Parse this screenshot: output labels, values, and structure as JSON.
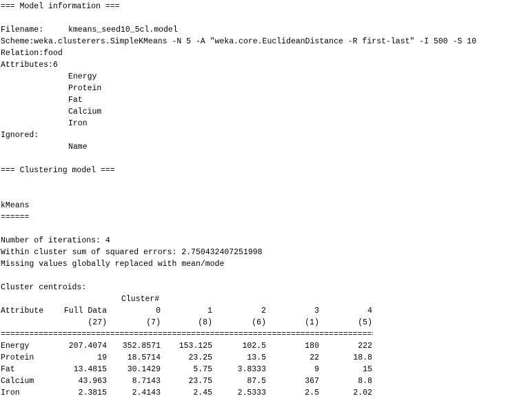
{
  "model_info": {
    "header": "=== Model information ===",
    "filename_label": "Filename:",
    "filename_value": "kmeans_seed10_5cl.model",
    "scheme": "Scheme:weka.clusterers.SimpleKMeans -N 5 -A \"weka.core.EuclideanDistance -R first-last\" -I 500 -S 10",
    "relation": "Relation:food",
    "attributes_label": "Attributes:6",
    "attributes": [
      "Energy",
      "Protein",
      "Fat",
      "Calcium",
      "Iron"
    ],
    "ignored_label": "Ignored:",
    "ignored": [
      "Name"
    ]
  },
  "clustering": {
    "header": "=== Clustering model ===",
    "algorithm": "kMeans",
    "algorithm_underline": "======",
    "iterations": "Number of iterations: 4",
    "sse": "Within cluster sum of squared errors: 2.750432407251998",
    "missing": "Missing values globally replaced with mean/mode",
    "centroids_label": "Cluster centroids:",
    "cluster_header": "Cluster#",
    "table": {
      "attr_header": "Attribute",
      "full_data_header": "Full Data",
      "cluster_ids": [
        "0",
        "1",
        "2",
        "3",
        "4"
      ],
      "full_data_count": "(27)",
      "cluster_counts": [
        "(7)",
        "(8)",
        "(6)",
        "(1)",
        "(5)"
      ],
      "separator": "=================================================================================",
      "rows": [
        {
          "attr": "Energy",
          "full": "207.4074",
          "c": [
            "352.8571",
            "153.125",
            "102.5",
            "180",
            "222"
          ]
        },
        {
          "attr": "Protein",
          "full": "19",
          "c": [
            "18.5714",
            "23.25",
            "13.5",
            "22",
            "18.8"
          ]
        },
        {
          "attr": "Fat",
          "full": "13.4815",
          "c": [
            "30.1429",
            "5.75",
            "3.8333",
            "9",
            "15"
          ]
        },
        {
          "attr": "Calcium",
          "full": "43.963",
          "c": [
            "8.7143",
            "23.75",
            "87.5",
            "367",
            "8.8"
          ]
        },
        {
          "attr": "Iron",
          "full": "2.3815",
          "c": [
            "2.4143",
            "2.45",
            "2.5333",
            "2.5",
            "2.02"
          ]
        }
      ]
    }
  }
}
